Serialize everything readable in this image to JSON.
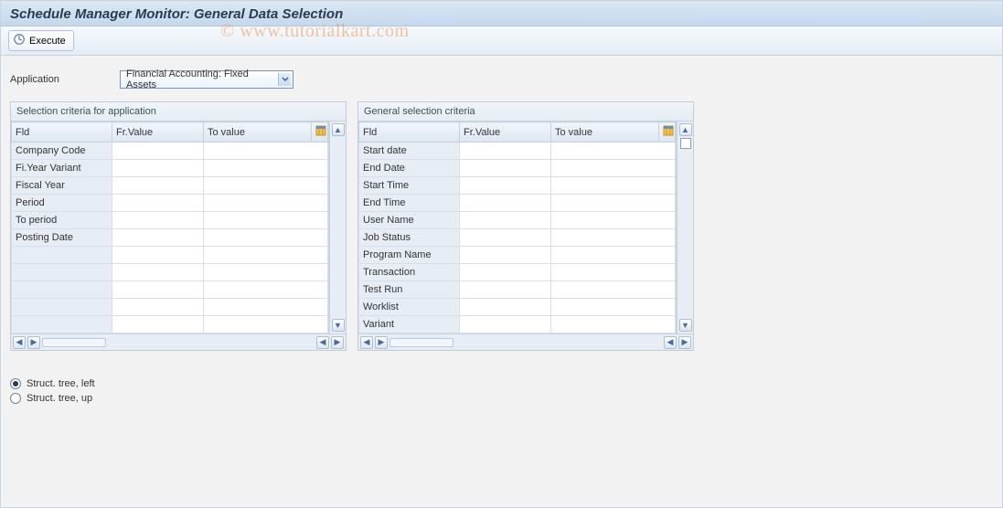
{
  "title": "Schedule Manager Monitor: General Data Selection",
  "toolbar": {
    "execute_label": "Execute"
  },
  "watermark": "© www.tutorialkart.com",
  "application": {
    "label": "Application",
    "value": "Financial Accounting: Fixed Assets"
  },
  "panel1": {
    "title": "Selection criteria for application",
    "headers": {
      "fld": "Fld",
      "fr": "Fr.Value",
      "to": "To value"
    },
    "rows": [
      {
        "fld": "Company Code",
        "fr": "",
        "to": ""
      },
      {
        "fld": "Fi.Year Variant",
        "fr": "",
        "to": ""
      },
      {
        "fld": "Fiscal Year",
        "fr": "",
        "to": ""
      },
      {
        "fld": "Period",
        "fr": "",
        "to": ""
      },
      {
        "fld": "To period",
        "fr": "",
        "to": ""
      },
      {
        "fld": "Posting Date",
        "fr": "",
        "to": ""
      },
      {
        "fld": "",
        "fr": "",
        "to": ""
      },
      {
        "fld": "",
        "fr": "",
        "to": ""
      },
      {
        "fld": "",
        "fr": "",
        "to": ""
      },
      {
        "fld": "",
        "fr": "",
        "to": ""
      },
      {
        "fld": "",
        "fr": "",
        "to": ""
      }
    ]
  },
  "panel2": {
    "title": "General selection criteria",
    "headers": {
      "fld": "Fld",
      "fr": "Fr.Value",
      "to": "To value"
    },
    "rows": [
      {
        "fld": "Start date",
        "fr": "",
        "to": ""
      },
      {
        "fld": "End Date",
        "fr": "",
        "to": ""
      },
      {
        "fld": "Start Time",
        "fr": "",
        "to": ""
      },
      {
        "fld": "End Time",
        "fr": "",
        "to": ""
      },
      {
        "fld": "User Name",
        "fr": "",
        "to": ""
      },
      {
        "fld": "Job Status",
        "fr": "",
        "to": ""
      },
      {
        "fld": "Program Name",
        "fr": "",
        "to": ""
      },
      {
        "fld": "Transaction",
        "fr": "",
        "to": ""
      },
      {
        "fld": "Test Run",
        "fr": "",
        "to": ""
      },
      {
        "fld": "Worklist",
        "fr": "",
        "to": ""
      },
      {
        "fld": "Variant",
        "fr": "",
        "to": ""
      }
    ]
  },
  "radios": {
    "left": "Struct. tree, left",
    "up": "Struct. tree, up",
    "selected": "left"
  }
}
